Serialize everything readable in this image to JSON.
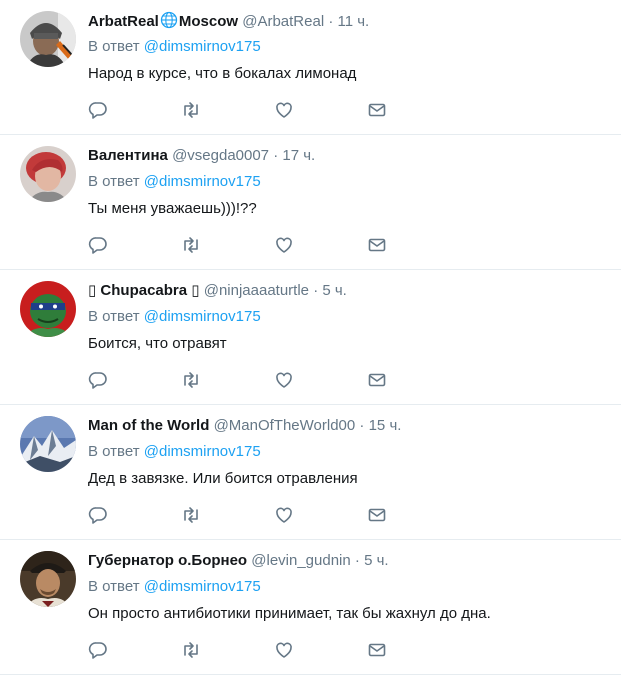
{
  "reply_prefix": "В ответ",
  "tweets": [
    {
      "name": "ArbatReal",
      "name_suffix": "Moscow",
      "handle": "@ArbatReal",
      "time": "11 ч.",
      "reply_to": "@dimsmirnov175",
      "text": "Народ в курсе, что в бокалах лимонад"
    },
    {
      "name": "Валентина",
      "handle": "@vsegda0007",
      "time": "17 ч.",
      "reply_to": "@dimsmirnov175",
      "text": "Ты меня уважаешь)))!??"
    },
    {
      "name": "▯ Chupacabra ▯",
      "handle": "@ninjaaaaturtle",
      "time": "5 ч.",
      "reply_to": "@dimsmirnov175",
      "text": "Боится, что отравят"
    },
    {
      "name": "Man of the World",
      "handle": "@ManOfTheWorld00",
      "time": "15 ч.",
      "reply_to": "@dimsmirnov175",
      "text": "Дед в завязке. Или боится отравления"
    },
    {
      "name": "Губернатор о.Борнео",
      "handle": "@levin_gudnin",
      "time": "5 ч.",
      "reply_to": "@dimsmirnov175",
      "text": "Он просто антибиотики принимает, так бы жахнул до дна."
    }
  ],
  "icons": [
    "reply-icon",
    "retweet-icon",
    "like-icon",
    "message-icon"
  ],
  "colors": {
    "name": "#14171a",
    "secondary": "#657786",
    "mention": "#1da1f2",
    "border": "#e6ecf0",
    "globe": "#1da1f2"
  }
}
